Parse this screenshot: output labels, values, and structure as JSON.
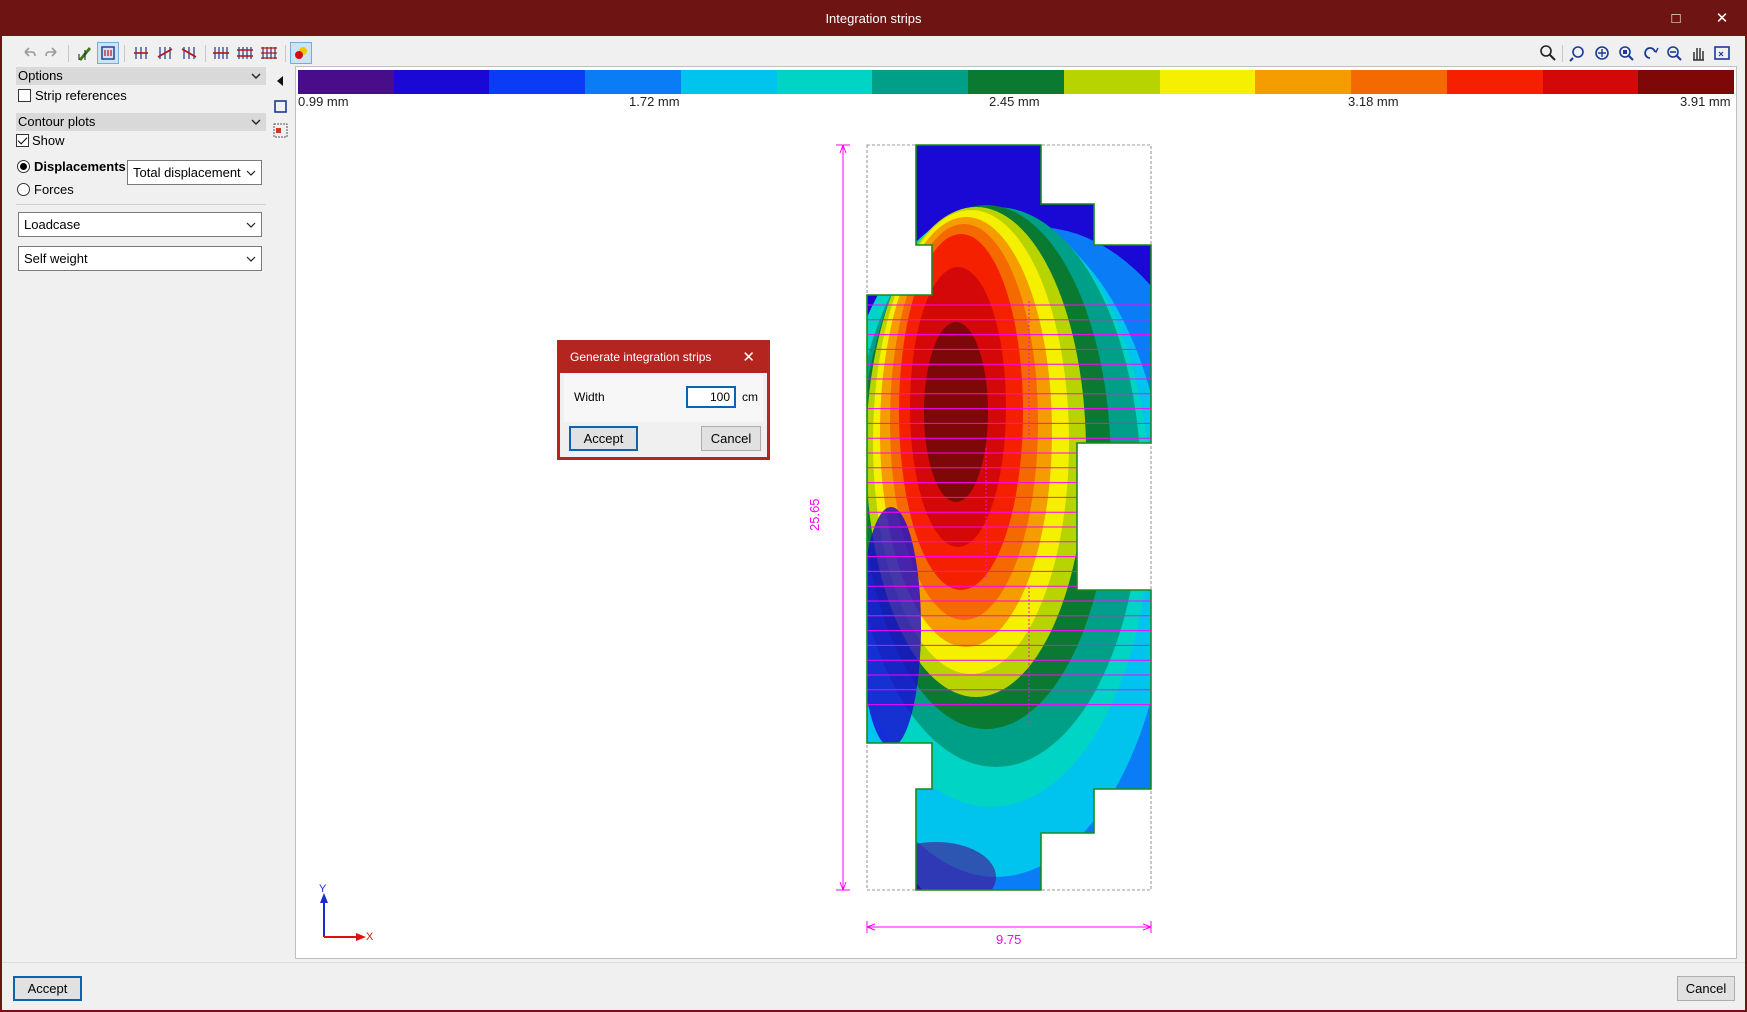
{
  "window": {
    "title": "Integration strips",
    "maximize_glyph": "□",
    "close_glyph": "✕"
  },
  "toolbar": {
    "left_icons": [
      "undo-icon",
      "redo-icon",
      "edit-strip-icon",
      "strip-layout-icon",
      "strip-add-1-icon",
      "strip-add-2-icon",
      "strip-add-3-icon",
      "strip-gen-1-icon",
      "strip-gen-2-icon",
      "strip-gen-3-icon",
      "contour-toggle-icon"
    ],
    "right_icons": [
      "search-icon",
      "zoom-prev-icon",
      "zoom-extents-icon",
      "zoom-window-icon",
      "rotate-view-icon",
      "zoom-out-icon",
      "pan-hand-icon",
      "view-2d-icon"
    ]
  },
  "options": {
    "header": "Options",
    "strip_references": {
      "label": "Strip references",
      "checked": false
    }
  },
  "contour": {
    "header": "Contour plots",
    "show": {
      "label": "Show",
      "checked": true
    },
    "displacements_label": "Displacements",
    "forces_label": "Forces",
    "selected": "Displacements",
    "displacement_type": "Total displacement",
    "loadcase_type": "Loadcase",
    "loadcase": "Self weight"
  },
  "legend": {
    "colors": [
      "#4a0d8a",
      "#1a08d4",
      "#0a3cf5",
      "#0a7cf5",
      "#00c4ee",
      "#00d4c4",
      "#00a088",
      "#0a7a32",
      "#b8d400",
      "#f5f000",
      "#f59c00",
      "#f56a00",
      "#f52000",
      "#d40808",
      "#7e0808"
    ],
    "labels": [
      "0.99 mm",
      "1.72 mm",
      "2.45 mm",
      "3.18 mm",
      "3.91 mm"
    ]
  },
  "dimensions": {
    "height": "25.65",
    "width": "9.75"
  },
  "axes": {
    "x": "X",
    "y": "Y"
  },
  "dialog": {
    "title": "Generate integration strips",
    "width_label": "Width",
    "width_value": "100",
    "unit": "cm",
    "accept": "Accept",
    "cancel": "Cancel"
  },
  "footer": {
    "accept": "Accept",
    "cancel": "Cancel"
  }
}
